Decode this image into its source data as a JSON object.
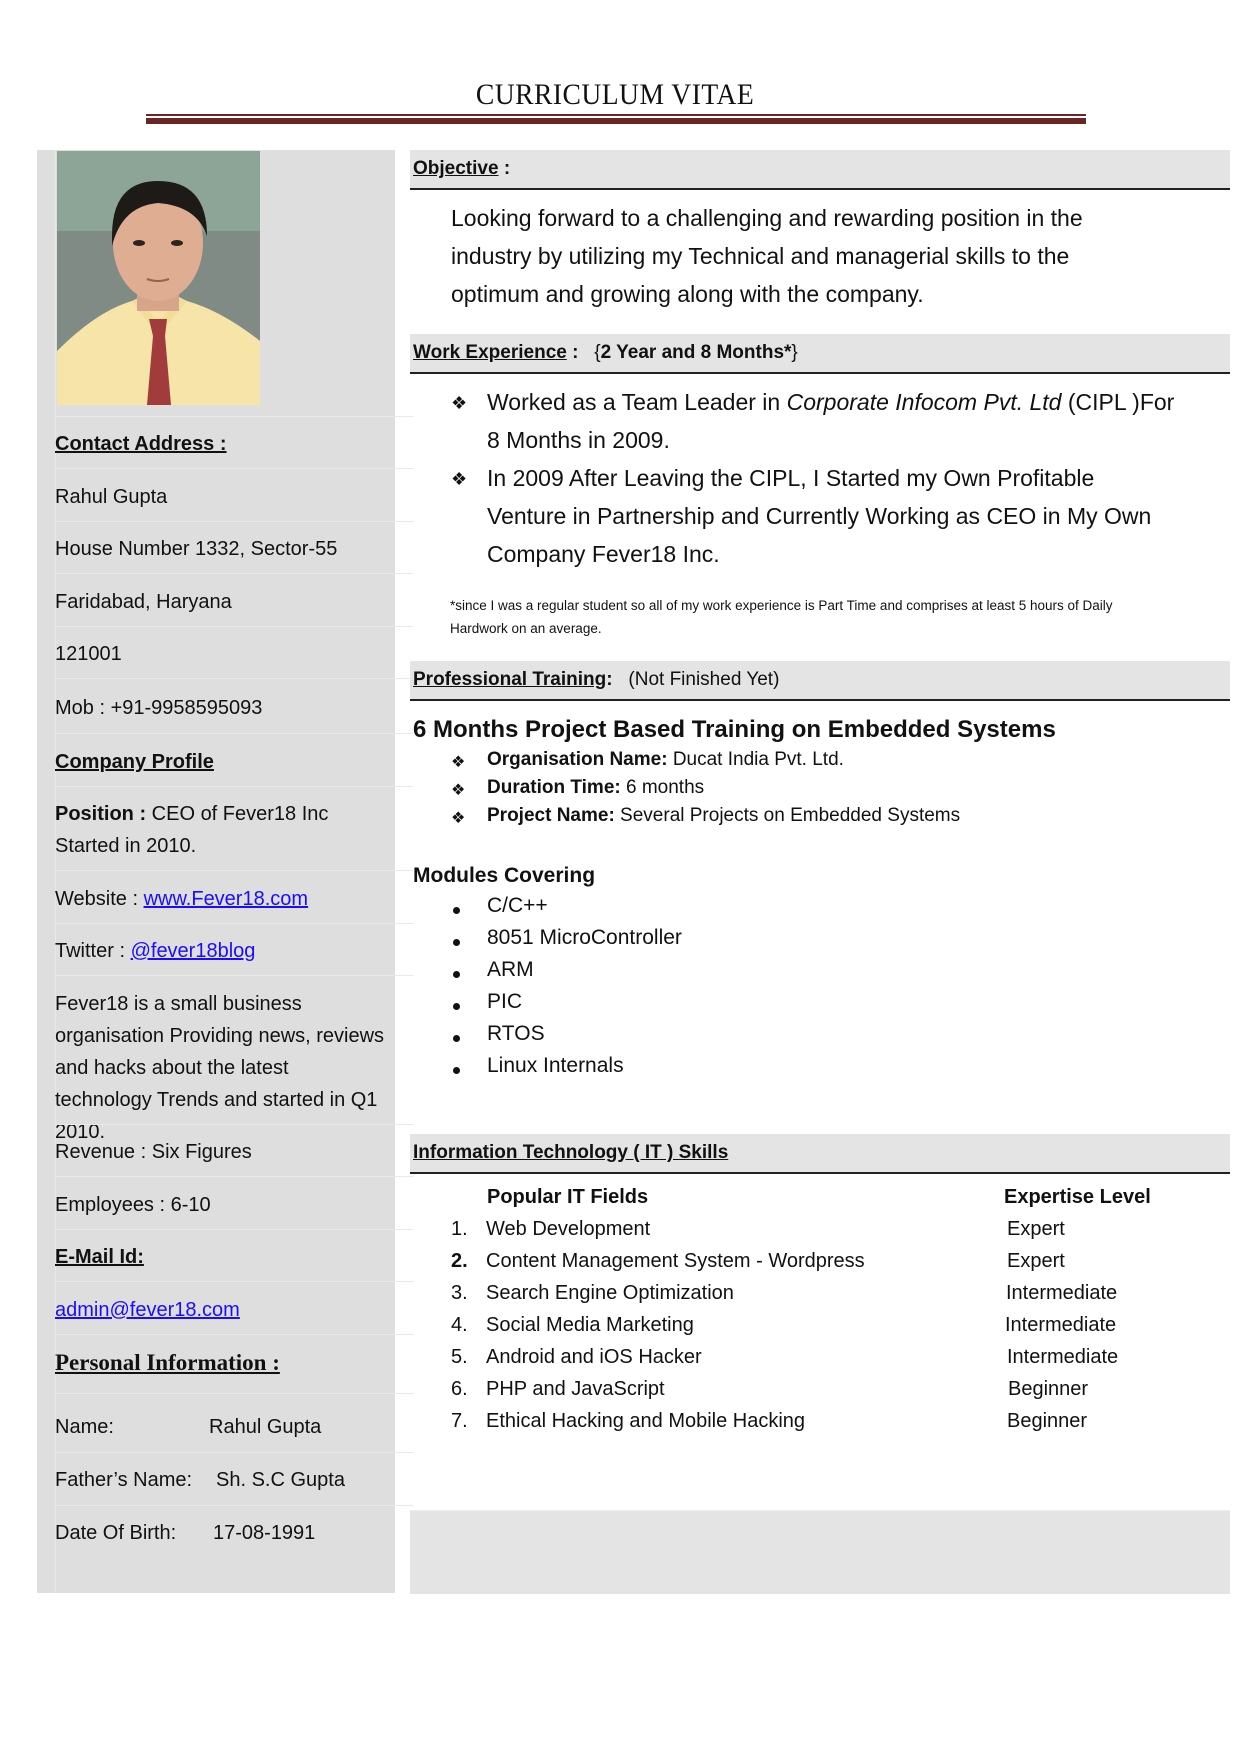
{
  "document": {
    "title": "CURRICULUM VITAE",
    "accent_color": "#6b2522",
    "link_color": "#1a0dff"
  },
  "sidebar": {
    "photo": {
      "icon": "portrait-photo",
      "description": "Passport photo of man in yellow shirt and red tie"
    },
    "contact_heading": "Contact  Address :",
    "contact_lines": [
      "Rahul Gupta",
      "House Number 1332, Sector-55",
      "Faridabad, Haryana",
      "121001",
      "Mob : +91-9958595093"
    ],
    "company_heading": "Company  Profile",
    "position_label": "Position :",
    "position_value": " CEO of Fever18 Inc",
    "position_line2": "Started in 2010.",
    "website_label": "Website : ",
    "website_link": "www.Fever18.com",
    "twitter_label": "Twitter : ",
    "twitter_link": "@fever18blog",
    "company_description": "Fever18 is a small business organisation Providing news, reviews and hacks about the latest technology Trends and started in Q1 2010.",
    "revenue": "Revenue : Six Figures",
    "employees": "Employees : 6-10",
    "email_heading": "E-Mail Id:",
    "email_link": "admin@fever18.com",
    "personal_heading": "Personal   Information :",
    "personal": [
      {
        "label": "Name:",
        "value": "Rahul Gupta"
      },
      {
        "label": "Father’s Name:",
        "value": "Sh. S.C Gupta"
      },
      {
        "label": "Date  Of  Birth:",
        "value": "17-08-1991"
      }
    ]
  },
  "main": {
    "objective": {
      "heading": "Objective",
      "colon": " :",
      "lines": [
        "Looking forward to a challenging and rewarding position in the",
        "industry by utilizing my Technical and managerial skills to the",
        "optimum and growing along with the company."
      ]
    },
    "work": {
      "heading": "Work Experience",
      "colon": " :",
      "duration": "2 Year and 8 Months*",
      "items": [
        {
          "pre": "Worked as a Team Leader in ",
          "italic": "Corporate Infocom Pvt. Ltd",
          "post": " (CIPL )For",
          "line2": "8 Months in 2009."
        },
        {
          "line1": "In 2009 After Leaving the CIPL, I Started my Own Profitable",
          "line2": "Venture in Partnership and Currently Working as CEO in My Own",
          "line3": "Company Fever18 Inc."
        }
      ],
      "footnote_line1": "*since  I was a regular student so all of my work experience is Part Time and comprises at least 5 hours of Daily",
      "footnote_line2": "Hardwork on an average."
    },
    "training": {
      "heading": "Professional Training",
      "colon": ":",
      "status": "(Not Finished Yet)",
      "title": "6 Months Project Based Training on Embedded Systems",
      "details": [
        {
          "label": "Organisation Name:",
          "value": " Ducat India Pvt. Ltd."
        },
        {
          "label": "Duration Time:",
          "value": " 6 months"
        },
        {
          "label": "Project Name:",
          "value": "  Several Projects on Embedded Systems"
        }
      ],
      "modules_heading": "Modules Covering",
      "modules": [
        "C/C++",
        "8051 MicroController",
        "ARM",
        "PIC",
        "RTOS",
        "Linux Internals"
      ]
    },
    "it_skills": {
      "heading": "Information Technology  ( IT ) Skills",
      "col_field": "Popular IT Fields",
      "col_level": "Expertise Level",
      "rows": [
        {
          "num": "1.",
          "field": "Web Development",
          "level": "Expert"
        },
        {
          "num": "2.",
          "field": "Content Management System  - Wordpress",
          "level": "Expert"
        },
        {
          "num": "3.",
          "field": "Search Engine Optimization",
          "level": "Intermediate"
        },
        {
          "num": "4.",
          "field": "Social Media Marketing",
          "level": "Intermediate"
        },
        {
          "num": "5.",
          "field": "Android and iOS Hacker",
          "level": "Intermediate"
        },
        {
          "num": "6.",
          "field": "PHP and JavaScript",
          "level": "Beginner"
        },
        {
          "num": "7.",
          "field": "Ethical Hacking and Mobile Hacking",
          "level": "Beginner"
        }
      ]
    }
  }
}
